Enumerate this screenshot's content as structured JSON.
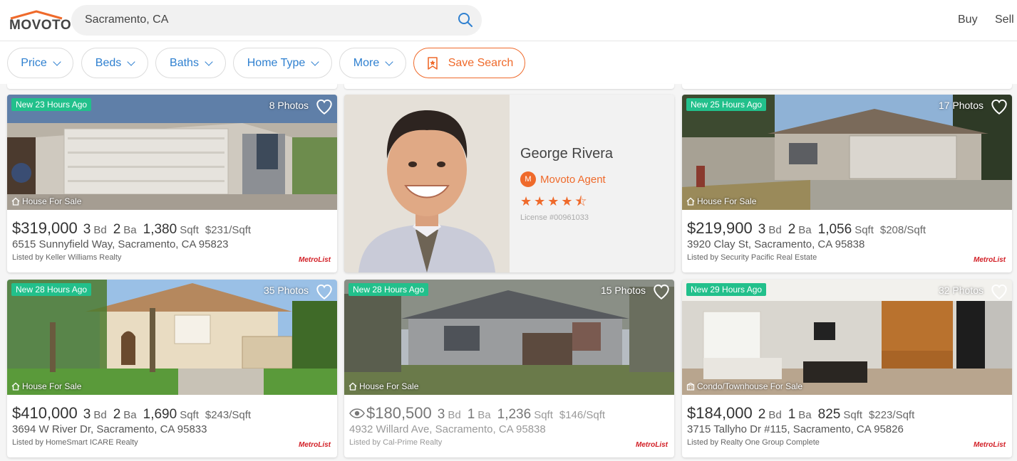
{
  "header": {
    "logo_text": "MOVOTO",
    "search_value": "Sacramento, CA",
    "nav": [
      "Buy",
      "Sell"
    ]
  },
  "filters": {
    "price": "Price",
    "beds": "Beds",
    "baths": "Baths",
    "home_type": "Home Type",
    "more": "More",
    "save_search": "Save Search"
  },
  "listings": [
    {
      "badge": "New 23 Hours Ago",
      "photos": "8 Photos",
      "type": "House For Sale",
      "price": "$319,000",
      "beds": "3",
      "baths": "2",
      "sqft": "1,380",
      "ppsf": "$231/Sqft",
      "address": "6515 Sunnyfield Way,  Sacramento,  CA 95823",
      "listed_by": "Listed by Keller Williams Realty",
      "mls": "MetroList"
    },
    {
      "badge": "New 25 Hours Ago",
      "photos": "17 Photos",
      "type": "House For Sale",
      "price": "$219,900",
      "beds": "3",
      "baths": "2",
      "sqft": "1,056",
      "ppsf": "$208/Sqft",
      "address": "3920 Clay St,  Sacramento,  CA 95838",
      "listed_by": "Listed by Security Pacific Real Estate",
      "mls": "MetroList"
    },
    {
      "badge": "New 28 Hours Ago",
      "photos": "35 Photos",
      "type": "House For Sale",
      "price": "$410,000",
      "beds": "3",
      "baths": "2",
      "sqft": "1,690",
      "ppsf": "$243/Sqft",
      "address": "3694 W River Dr,  Sacramento,  CA 95833",
      "listed_by": "Listed by HomeSmart ICARE Realty",
      "mls": "MetroList"
    },
    {
      "badge": "New 28 Hours Ago",
      "photos": "15 Photos",
      "type": "House For Sale",
      "price": "$180,500",
      "beds": "3",
      "baths": "1",
      "sqft": "1,236",
      "ppsf": "$146/Sqft",
      "address": "4932 Willard Ave,  Sacramento,  CA 95838",
      "listed_by": "Listed by Cal-Prime Realty",
      "mls": "MetroList"
    },
    {
      "badge": "New 29 Hours Ago",
      "photos": "32 Photos",
      "type": "Condo/Townhouse For Sale",
      "price": "$184,000",
      "beds": "2",
      "baths": "1",
      "sqft": "825",
      "ppsf": "$223/Sqft",
      "address": "3715 Tallyho Dr #115,  Sacramento,  CA 95826",
      "listed_by": "Listed by Realty One Group Complete",
      "mls": "MetroList"
    }
  ],
  "labels": {
    "bd": "Bd",
    "ba": "Ba",
    "sqft": "Sqft"
  },
  "agent": {
    "name": "George Rivera",
    "m": "M",
    "role": "Movoto Agent",
    "rating": 4.5,
    "stars": "★★★★⯪",
    "license": "License #00961033"
  },
  "colors": {
    "accent": "#ef6a2b",
    "link": "#2f80d0",
    "badge": "#22c08b",
    "mls": "#d21f26"
  }
}
